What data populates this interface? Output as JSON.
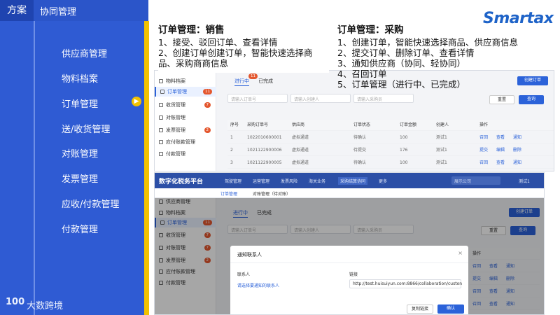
{
  "sidebar": {
    "tag": "方案",
    "title": "协同管理",
    "items": [
      "供应商管理",
      "物料档案",
      "订单管理",
      "送/收货管理",
      "对账管理",
      "发票管理",
      "应收/付款管理",
      "付款管理"
    ],
    "logo_mark": "100",
    "logo_text": "大数跨境"
  },
  "brand": "Smartax",
  "desc_left": {
    "title": "订单管理：销售",
    "lines": "1、接受、驳回订单、查看详情\n2、创建订单创建订单，智能快速选择商品、采购商商信息"
  },
  "desc_right": {
    "title": "订单管理：采购",
    "lines": "1、创建订单，智能快速选择商品、供应商信息\n2、提交订单、删除订单、查看详情\n3、通知供应商（协同、轻协同）\n4、召回订单\n5、订单管理（进行中、已完成）"
  },
  "shot1": {
    "nav": [
      "物料档案",
      "订单管理",
      "收货管理",
      "对账管理",
      "发票管理",
      "应付账款管理",
      "付款管理"
    ],
    "badges": [
      "11",
      "7",
      "2",
      "2"
    ],
    "tabs": [
      "进行中",
      "已完成"
    ],
    "tab_badge": "11",
    "inputs": [
      "请输入订单号",
      "请输入创建人",
      "请输入采购员"
    ],
    "btn_create": "创建订单",
    "btn_reset": "重置",
    "btn_search": "查询",
    "headers": [
      "序号",
      "采购订单号",
      "供应商",
      "订单状态",
      "订单金额",
      "创建人",
      "操作"
    ],
    "rows": [
      [
        "1",
        "1022010600001",
        "虚拟通道",
        "待确认",
        "100",
        "测试1",
        "召回",
        "查看",
        "通知"
      ],
      [
        "2",
        "1021122900006",
        "虚拟通道",
        "待提交",
        "176",
        "测试1",
        "提交",
        "编辑",
        "删除"
      ],
      [
        "3",
        "1021122900005",
        "虚拟通道",
        "待确认",
        "100",
        "测试1",
        "召回",
        "查看",
        "通知"
      ]
    ]
  },
  "shot2": {
    "logo": "数字化税务平台",
    "menus": [
      "驾驶管理",
      "运营管理",
      "发票风险",
      "海关业务",
      "采购结算协同",
      "更多"
    ],
    "company": "展示公司",
    "user": "测试1",
    "subtabs": [
      "订单管理",
      "对账管理（待对账）"
    ],
    "nav": [
      "供应商管理",
      "物料档案",
      "订单管理",
      "收货管理",
      "对账管理",
      "发票管理",
      "应付账款管理",
      "付款管理"
    ],
    "badges": [
      "11",
      "7",
      "7",
      "2"
    ],
    "tabs": [
      "进行中",
      "已完成"
    ],
    "inputs": [
      "请输入订单号",
      "请输入创建人",
      "请输入采购员"
    ],
    "btn_create": "创建订单",
    "btn_reset": "重置",
    "btn_search": "查询",
    "op_header": "操作",
    "ops": [
      [
        "召回",
        "查看",
        "通知"
      ],
      [
        "提交",
        "编辑",
        "删除"
      ],
      [
        "召回",
        "查看",
        "通知"
      ],
      [
        "召回",
        "查看",
        "通知"
      ],
      [
        "撤回",
        "查看",
        "停止收货"
      ]
    ],
    "dialog": {
      "title": "通知联系人",
      "close": "×",
      "col_contact": "联系人",
      "col_link": "链接",
      "contact_placeholder": "请选择要通知的联系人",
      "link_value": "http://test.huisuiyun.com:8866/collaboration/custon",
      "btn_copy": "复制链接",
      "btn_ok": "确认"
    }
  }
}
